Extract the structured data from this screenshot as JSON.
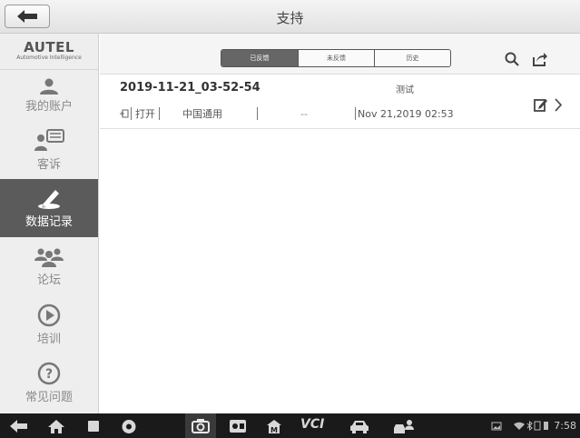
{
  "header": {
    "title": "支持"
  },
  "logo": {
    "brand": "AUTEL",
    "tagline": "Automotive Intelligence"
  },
  "sidebar": {
    "items": [
      {
        "label": "我的账户",
        "icon": "person-icon"
      },
      {
        "label": "客诉",
        "icon": "chat-icon"
      },
      {
        "label": "数据记录",
        "icon": "pen-icon",
        "active": true
      },
      {
        "label": "论坛",
        "icon": "group-icon"
      },
      {
        "label": "培训",
        "icon": "play-circle-icon"
      },
      {
        "label": "常见问题",
        "icon": "question-icon"
      }
    ]
  },
  "toolbar": {
    "tabs": [
      "已反馈",
      "未反馈",
      "历史"
    ],
    "selected_tab": "已反馈"
  },
  "record": {
    "name": "2019-11-21_03-52-54",
    "title": "测试",
    "open_label": "打开",
    "vehicle": "中国通用",
    "dash": "--",
    "date": "Nov 21,2019 02:53"
  },
  "statusbar": {
    "time": "7:58"
  },
  "colors": {
    "active_bg": "#5b5b5b",
    "sidebar_bg": "#eeeeee",
    "navbar_bg": "#1a1a1a"
  }
}
